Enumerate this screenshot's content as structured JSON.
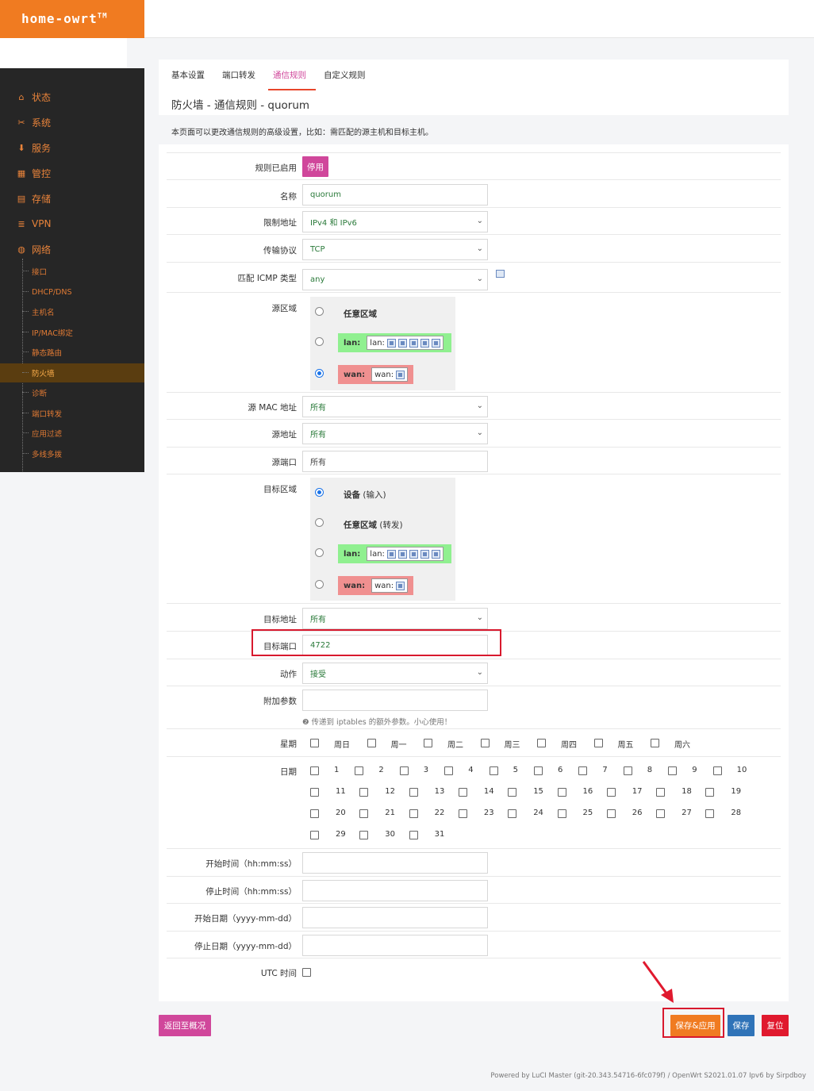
{
  "brand": {
    "name": "home-owrt",
    "mark": "TM"
  },
  "sidebar": {
    "items": [
      {
        "label": "状态",
        "icon": "home-icon"
      },
      {
        "label": "系统",
        "icon": "tools-icon"
      },
      {
        "label": "服务",
        "icon": "download-icon"
      },
      {
        "label": "管控",
        "icon": "calendar-icon"
      },
      {
        "label": "存储",
        "icon": "storage-icon"
      },
      {
        "label": "VPN",
        "icon": "list-icon"
      },
      {
        "label": "网络",
        "icon": "globe-icon"
      }
    ],
    "sub_items": [
      {
        "label": "接口"
      },
      {
        "label": "DHCP/DNS"
      },
      {
        "label": "主机名"
      },
      {
        "label": "IP/MAC绑定"
      },
      {
        "label": "静态路由"
      },
      {
        "label": "防火墙",
        "active": true
      },
      {
        "label": "诊断"
      },
      {
        "label": "端口转发"
      },
      {
        "label": "应用过滤"
      },
      {
        "label": "多线多拨"
      }
    ]
  },
  "tabs": [
    {
      "label": "基本设置"
    },
    {
      "label": "端口转发"
    },
    {
      "label": "通信规则",
      "active": true
    },
    {
      "label": "自定义规则"
    }
  ],
  "page_title": "防火墙 - 通信规则 - quorum",
  "description": "本页面可以更改通信规则的高级设置，比如：需匹配的源主机和目标主机。",
  "form": {
    "enabled": {
      "label": "规则已启用",
      "button": "停用"
    },
    "name": {
      "label": "名称",
      "value": "quorum"
    },
    "family": {
      "label": "限制地址",
      "value": "IPv4 和 IPv6"
    },
    "proto": {
      "label": "传输协议",
      "value": "TCP"
    },
    "icmp": {
      "label": "匹配 ICMP 类型",
      "value": "any"
    },
    "src_zone": {
      "label": "源区域",
      "any_label": "任意区域",
      "lan": {
        "name": "lan:",
        "inner": "lan:"
      },
      "wan": {
        "name": "wan:",
        "inner": "wan:"
      }
    },
    "src_mac": {
      "label": "源 MAC 地址",
      "value": "所有"
    },
    "src_ip": {
      "label": "源地址",
      "value": "所有"
    },
    "src_port": {
      "label": "源端口",
      "placeholder": "所有"
    },
    "dest_zone": {
      "label": "目标区域",
      "device_label": "设备",
      "device_note": "(输入)",
      "any_label": "任意区域",
      "any_note": "(转发)",
      "lan": {
        "name": "lan:",
        "inner": "lan:"
      },
      "wan": {
        "name": "wan:",
        "inner": "wan:"
      }
    },
    "dest_ip": {
      "label": "目标地址",
      "value": "所有"
    },
    "dest_port": {
      "label": "目标端口",
      "value": "4722"
    },
    "target": {
      "label": "动作",
      "value": "接受"
    },
    "extra": {
      "label": "附加参数",
      "hint": "❷ 传递到 iptables 的额外参数。小心使用！"
    },
    "weekdays": {
      "label": "星期",
      "days": [
        "周日",
        "周一",
        "周二",
        "周三",
        "周四",
        "周五",
        "周六"
      ]
    },
    "monthdays": {
      "label": "日期",
      "days": [
        "1",
        "2",
        "3",
        "4",
        "5",
        "6",
        "7",
        "8",
        "9",
        "10",
        "11",
        "12",
        "13",
        "14",
        "15",
        "16",
        "17",
        "18",
        "19",
        "20",
        "21",
        "22",
        "23",
        "24",
        "25",
        "26",
        "27",
        "28",
        "29",
        "30",
        "31"
      ]
    },
    "start_time": {
      "label": "开始时间（hh:mm:ss）"
    },
    "stop_time": {
      "label": "停止时间（hh:mm:ss）"
    },
    "start_date": {
      "label": "开始日期（yyyy-mm-dd）"
    },
    "stop_date": {
      "label": "停止日期（yyyy-mm-dd）"
    },
    "utc": {
      "label": "UTC 时间"
    }
  },
  "actions": {
    "back": "返回至概况",
    "save_apply": "保存&应用",
    "save": "保存",
    "reset": "复位"
  },
  "footer": "Powered by LuCI Master (git-20.343.54716-6fc079f) / OpenWrt S2021.01.07 Ipv6 by Sirpdboy",
  "colors": {
    "brand": "#f07b21",
    "accent": "#d0479b",
    "save_apply": "#f07b21",
    "save": "#2f73b8",
    "reset": "#e0192e",
    "highlight": "#d8192e"
  }
}
